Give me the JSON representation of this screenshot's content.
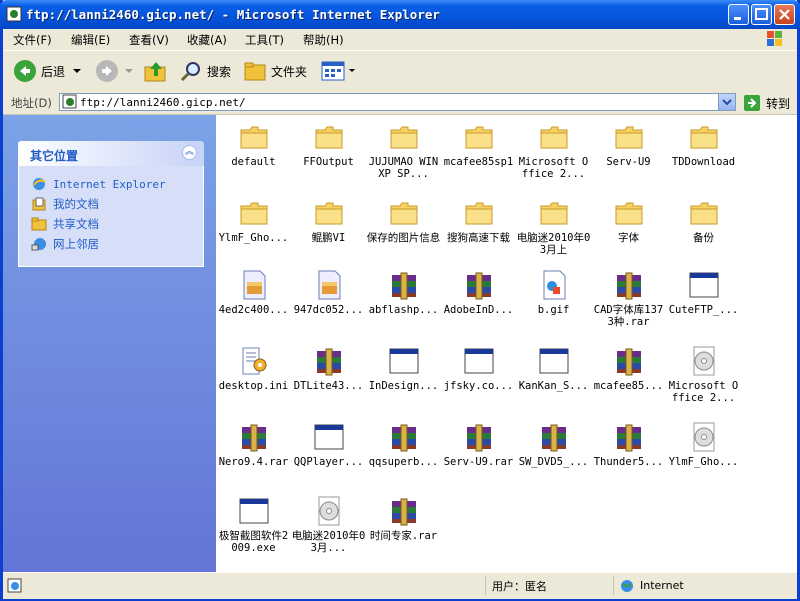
{
  "window": {
    "title": "ftp://lanni2460.gicp.net/ - Microsoft Internet Explorer"
  },
  "menu": [
    "文件(F)",
    "编辑(E)",
    "查看(V)",
    "收藏(A)",
    "工具(T)",
    "帮助(H)"
  ],
  "toolbar": {
    "back": "后退",
    "search": "搜索",
    "folders": "文件夹"
  },
  "address": {
    "label": "地址(D)",
    "value": "ftp://lanni2460.gicp.net/",
    "go": "转到"
  },
  "tasks": {
    "header": "其它位置",
    "items": [
      "Internet Explorer",
      "我的文档",
      "共享文档",
      "网上邻居"
    ]
  },
  "files": [
    {
      "name": "default",
      "type": "folder"
    },
    {
      "name": "FFOutput",
      "type": "folder"
    },
    {
      "name": "JUJUMAO WINXP SP...",
      "type": "folder"
    },
    {
      "name": "mcafee85sp1",
      "type": "folder"
    },
    {
      "name": "Microsoft Office 2...",
      "type": "folder"
    },
    {
      "name": "Serv-U9",
      "type": "folder"
    },
    {
      "name": "TDDownload",
      "type": "folder"
    },
    {
      "name": "YlmF_Gho...",
      "type": "folder"
    },
    {
      "name": "鲲鹏VI",
      "type": "folder"
    },
    {
      "name": "保存的图片信息",
      "type": "folder"
    },
    {
      "name": "搜狗高速下载",
      "type": "folder"
    },
    {
      "name": "电脑迷2010年03月上",
      "type": "folder"
    },
    {
      "name": "字体",
      "type": "folder"
    },
    {
      "name": "备份",
      "type": "folder"
    },
    {
      "name": "4ed2c400...",
      "type": "image"
    },
    {
      "name": "947dc052...",
      "type": "image"
    },
    {
      "name": "abflashp...",
      "type": "rar"
    },
    {
      "name": "AdobeInD...",
      "type": "rar"
    },
    {
      "name": "b.gif",
      "type": "gif"
    },
    {
      "name": "CAD字体库1373种.rar",
      "type": "rar"
    },
    {
      "name": "CuteFTP_...",
      "type": "exe"
    },
    {
      "name": "desktop.ini",
      "type": "ini"
    },
    {
      "name": "DTLite43...",
      "type": "rar"
    },
    {
      "name": "InDesign...",
      "type": "exe"
    },
    {
      "name": "jfsky.co...",
      "type": "exe"
    },
    {
      "name": "KanKan_S...",
      "type": "exe"
    },
    {
      "name": "mcafee85...",
      "type": "rar"
    },
    {
      "name": "Microsoft Office 2...",
      "type": "iso"
    },
    {
      "name": "Nero9.4.rar",
      "type": "rar"
    },
    {
      "name": "QQPlayer...",
      "type": "exe"
    },
    {
      "name": "qqsuperb...",
      "type": "rar"
    },
    {
      "name": "Serv-U9.rar",
      "type": "rar"
    },
    {
      "name": "SW_DVD5_...",
      "type": "rar"
    },
    {
      "name": "Thunder5...",
      "type": "rar"
    },
    {
      "name": "YlmF_Gho...",
      "type": "iso"
    },
    {
      "name": "极智截图软件2009.exe",
      "type": "exe"
    },
    {
      "name": "电脑迷2010年03月...",
      "type": "iso"
    },
    {
      "name": "时间专家.rar",
      "type": "rar"
    }
  ],
  "status": {
    "user": "用户：匿名",
    "zone": "Internet"
  },
  "colors": {
    "titlebar": "#0654dc",
    "taskpane": "#7ba2e7",
    "link": "#215dc6"
  }
}
